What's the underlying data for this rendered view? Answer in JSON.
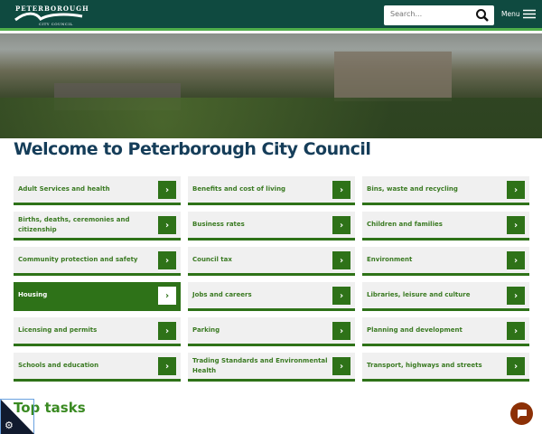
{
  "header": {
    "logo_top": "PETERBOROUGH",
    "logo_bottom": "CITY COUNCIL",
    "search_placeholder": "Search...",
    "menu_label": "Menu"
  },
  "page_title": "Welcome to Peterborough City Council",
  "services": [
    {
      "label": "Adult Services and health"
    },
    {
      "label": "Benefits and cost of living"
    },
    {
      "label": "Bins, waste and recycling"
    },
    {
      "label": "Births, deaths, ceremonies and citizenship"
    },
    {
      "label": "Business rates"
    },
    {
      "label": "Children and families"
    },
    {
      "label": "Community protection and safety"
    },
    {
      "label": "Council tax"
    },
    {
      "label": "Environment"
    },
    {
      "label": "Housing",
      "active": true
    },
    {
      "label": "Jobs and careers"
    },
    {
      "label": "Libraries, leisure and culture"
    },
    {
      "label": "Licensing and permits"
    },
    {
      "label": "Parking"
    },
    {
      "label": "Planning and development"
    },
    {
      "label": "Schools and education"
    },
    {
      "label": "Trading Standards and Environmental Health"
    },
    {
      "label": "Transport, highways and streets"
    }
  ],
  "arrow": "›",
  "top_tasks_heading": "Top tasks",
  "colors": {
    "header": "#0f4a40",
    "accent": "#2e7218",
    "title": "#153d59",
    "chat": "#8c3006"
  }
}
